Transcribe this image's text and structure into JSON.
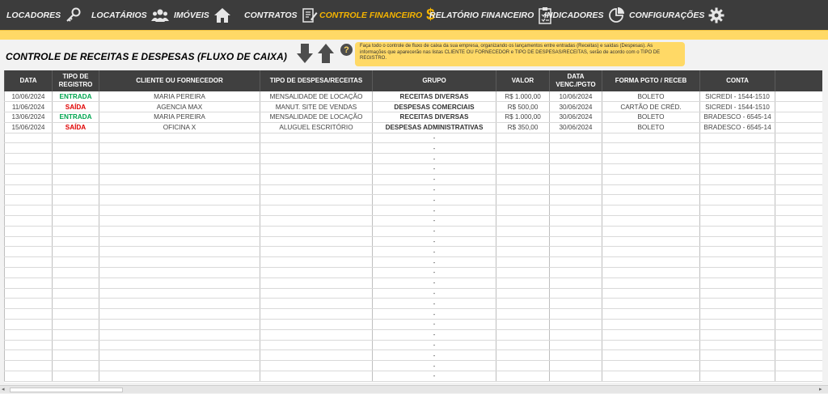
{
  "nav": {
    "items": [
      {
        "label": "LOCADORES",
        "icon": "keys-icon"
      },
      {
        "label": "LOCATÁRIOS",
        "icon": "users-icon"
      },
      {
        "label": "IMÓVEIS",
        "icon": "home-icon"
      },
      {
        "label": "CONTRATOS",
        "icon": "contract-icon"
      },
      {
        "label": "CONTROLE FINANCEIRO",
        "icon": "dollar-icon",
        "active": true
      },
      {
        "label": "RELATÓRIO FINANCEIRO",
        "icon": "clipboard-icon"
      },
      {
        "label": "INDICADORES",
        "icon": "pie-chart-icon"
      },
      {
        "label": "CONFIGURAÇÕES",
        "icon": "gear-icon"
      }
    ]
  },
  "page": {
    "title": "CONTROLE DE RECEITAS E DESPESAS (FLUXO DE CAIXA)",
    "help_text": "Faça todo o controle de fluxo de caixa da sua empresa, organizando os lançamentos entre entradas (Receitas) e saídas (Despesas). As informações que aparecerão nas listas CLIENTE OU FORNECEDOR e TIPO DE DESPESAS/RECEITAS, serão de acordo com o TIPO DE REGISTRO."
  },
  "table": {
    "headers": [
      "DATA",
      "TIPO DE REGISTRO",
      "CLIENTE OU FORNECEDOR",
      "TIPO DE DESPESA/RECEITAS",
      "GRUPO",
      "VALOR",
      "DATA VENC./PGTO",
      "FORMA PGTO / RECEB",
      "CONTA"
    ],
    "rows": [
      [
        "10/06/2024",
        "ENTRADA",
        "MARIA PEREIRA",
        "MENSALIDADE DE LOCAÇÃO",
        "RECEITAS DIVERSAS",
        "R$ 1.000,00",
        "10/06/2024",
        "BOLETO",
        "SICREDI - 1544-1510"
      ],
      [
        "11/06/2024",
        "SAÍDA",
        "AGENCIA MAX",
        "MANUT. SITE DE VENDAS",
        "DESPESAS COMERCIAIS",
        "R$ 500,00",
        "30/06/2024",
        "CARTÃO DE CRÉD.",
        "SICREDI - 1544-1510"
      ],
      [
        "13/06/2024",
        "ENTRADA",
        "MARIA PEREIRA",
        "MENSALIDADE DE LOCAÇÃO",
        "RECEITAS DIVERSAS",
        "R$ 1.000,00",
        "30/06/2024",
        "BOLETO",
        "BRADESCO - 6545-14"
      ],
      [
        "15/06/2024",
        "SAÍDA",
        "OFICINA X",
        "ALUGUEL ESCRITÓRIO",
        "DESPESAS ADMINISTRATIVAS",
        "R$ 350,00",
        "30/06/2024",
        "BOLETO",
        "BRADESCO - 6545-14"
      ]
    ],
    "empty_group_placeholder": "-",
    "empty_row_count": 24
  },
  "colors": {
    "nav_bg": "#3c3c3c",
    "accent": "#f5b400",
    "stripe": "#ffd966",
    "header_bg": "#404040",
    "entrada": "#00a550",
    "saida": "#e00000"
  }
}
